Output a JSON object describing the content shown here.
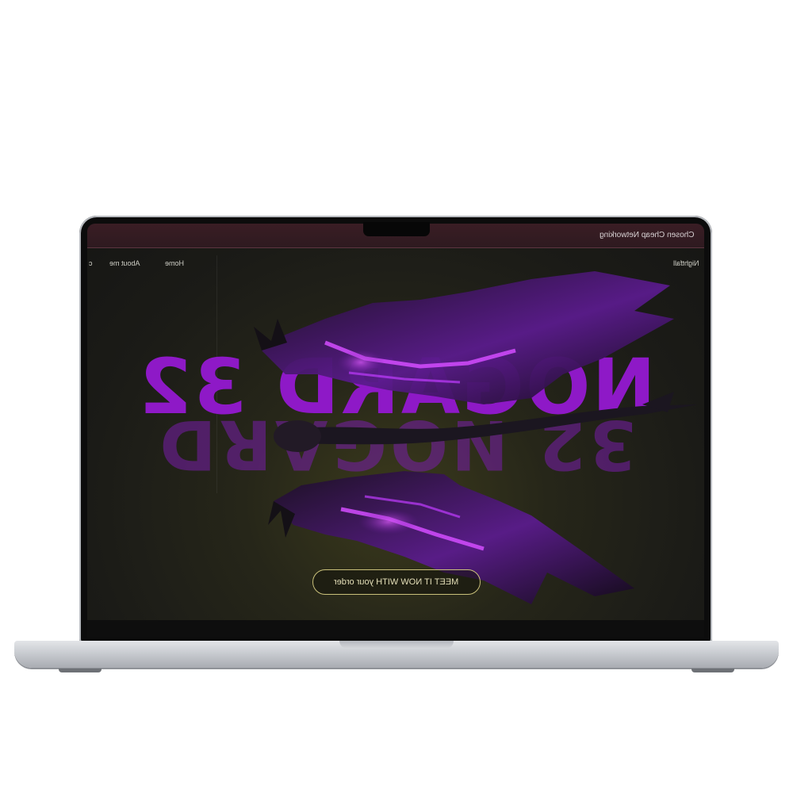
{
  "topbar": {
    "message": "Chosen Cheap Networking"
  },
  "nav": {
    "logo": "Nightfall",
    "items": [
      "Home",
      "About me"
    ],
    "edge_glyph": "c"
  },
  "hero": {
    "title": "NOGARD 32",
    "reflection": "32 NOGARD",
    "cta_label": "MEET IT NOW WITH your order"
  },
  "colors": {
    "title": "#8e19c7",
    "topbar": "#3a1d24",
    "cta_border": "#c9c07a",
    "dragon_glow": "#b030ff"
  }
}
